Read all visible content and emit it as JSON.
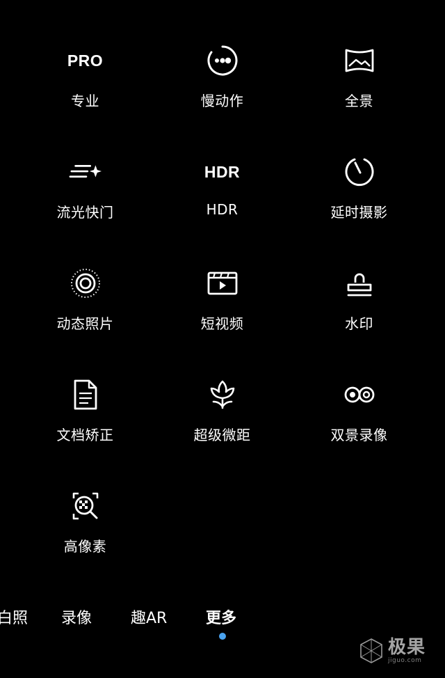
{
  "modes": [
    {
      "label": "专业",
      "icon": "pro-text-icon",
      "icon_text": "PRO"
    },
    {
      "label": "慢动作",
      "icon": "slow-motion-icon"
    },
    {
      "label": "全景",
      "icon": "panorama-icon"
    },
    {
      "label": "流光快门",
      "icon": "light-painting-icon"
    },
    {
      "label": "HDR",
      "icon": "hdr-text-icon",
      "icon_text": "HDR"
    },
    {
      "label": "延时摄影",
      "icon": "timelapse-icon"
    },
    {
      "label": "动态照片",
      "icon": "moving-picture-icon"
    },
    {
      "label": "短视频",
      "icon": "short-video-icon"
    },
    {
      "label": "水印",
      "icon": "watermark-stamp-icon"
    },
    {
      "label": "文档矫正",
      "icon": "document-correction-icon"
    },
    {
      "label": "超级微距",
      "icon": "super-macro-icon"
    },
    {
      "label": "双景录像",
      "icon": "dual-view-icon"
    },
    {
      "label": "高像素",
      "icon": "high-resolution-icon"
    }
  ],
  "tabs": [
    {
      "label": "拍照",
      "visible_text": "白照"
    },
    {
      "label": "录像"
    },
    {
      "label": "趣AR"
    },
    {
      "label": "更多",
      "active": true
    }
  ],
  "tab_labels": {
    "photo": "白照",
    "video": "录像",
    "ar": "趣AR",
    "more": "更多"
  },
  "watermark": {
    "main": "极果",
    "sub": "jiguo.com"
  },
  "colors": {
    "background": "#000000",
    "text": "#ffffff",
    "active_indicator": "#4aa3f0"
  }
}
